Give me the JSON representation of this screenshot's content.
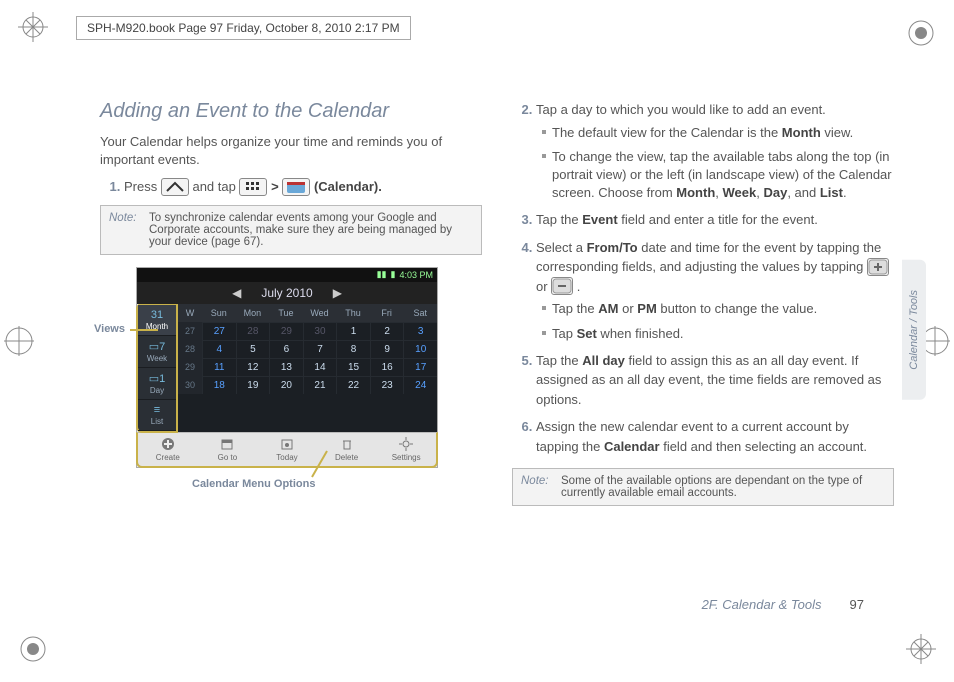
{
  "header": {
    "runhead": "SPH-M920.book  Page 97  Friday, October 8, 2010  2:17 PM"
  },
  "section": {
    "title": "Adding an Event to the Calendar",
    "intro": "Your Calendar helps organize your time and reminds you of important events."
  },
  "left": {
    "step1_a": "Press ",
    "step1_b": " and tap ",
    "step1_c": " > ",
    "step1_d": " (Calendar).",
    "note_label": "Note:",
    "note1": "To synchronize calendar events among your Google and Corporate accounts, make sure they are being managed by your device (page 67).",
    "views_label": "Views",
    "menu_label": "Calendar Menu Options"
  },
  "phone": {
    "time": "4:03 PM",
    "month_title": "July 2010",
    "tabs": [
      "Month",
      "Week",
      "Day",
      "List"
    ],
    "dow_hdr": "W",
    "dow": [
      "Sun",
      "Mon",
      "Tue",
      "Wed",
      "Thu",
      "Fri",
      "Sat"
    ],
    "rows": [
      {
        "wk": "27",
        "days": [
          "27",
          "28",
          "29",
          "30",
          "1",
          "2",
          "3"
        ],
        "dim": [
          0,
          1,
          2,
          3
        ]
      },
      {
        "wk": "28",
        "days": [
          "4",
          "5",
          "6",
          "7",
          "8",
          "9",
          "10"
        ]
      },
      {
        "wk": "29",
        "days": [
          "11",
          "12",
          "13",
          "14",
          "15",
          "16",
          "17"
        ]
      },
      {
        "wk": "30",
        "days": [
          "18",
          "19",
          "20",
          "21",
          "22",
          "23",
          "24"
        ]
      }
    ],
    "menu": [
      "Create",
      "Go to",
      "Today",
      "Delete",
      "Settings"
    ]
  },
  "right": {
    "s2": "Tap a day to which you would like to add an event.",
    "s2a_a": "The default view for the Calendar is the ",
    "s2a_b": "Month",
    "s2a_c": " view.",
    "s2b_a": "To change the view, tap the available tabs along the top (in portrait view) or the left (in landscape view) of the Calendar screen. Choose from ",
    "s2b_b": "Month",
    "s2b_c": ", ",
    "s2b_d": "Week",
    "s2b_e": ", ",
    "s2b_f": "Day",
    "s2b_g": ", and ",
    "s2b_h": "List",
    "s2b_i": ".",
    "s3_a": "Tap the ",
    "s3_b": "Event",
    "s3_c": " field and enter a title for the event.",
    "s4_a": "Select a ",
    "s4_b": "From/To",
    "s4_c": " date and time for the event by tapping the corresponding fields, and adjusting the values by tapping ",
    "s4_d": " or ",
    "s4_e": ".",
    "s4x_a": "Tap the ",
    "s4x_b": "AM",
    "s4x_c": " or ",
    "s4x_d": "PM",
    "s4x_e": " button to change the value.",
    "s4y_a": "Tap ",
    "s4y_b": "Set",
    "s4y_c": " when finished.",
    "s5_a": "Tap the ",
    "s5_b": "All day",
    "s5_c": " field to assign this as an all day event. If assigned as an all day event, the time fields are removed as options.",
    "s6_a": "Assign the new calendar event to a current account by tapping the ",
    "s6_b": "Calendar",
    "s6_c": " field and then selecting an account.",
    "note2": "Some of the available options are dependant on the type of currently available email accounts."
  },
  "sidetab": "Calendar / Tools",
  "footer": {
    "chapter": "2F. Calendar & Tools",
    "page": "97"
  }
}
